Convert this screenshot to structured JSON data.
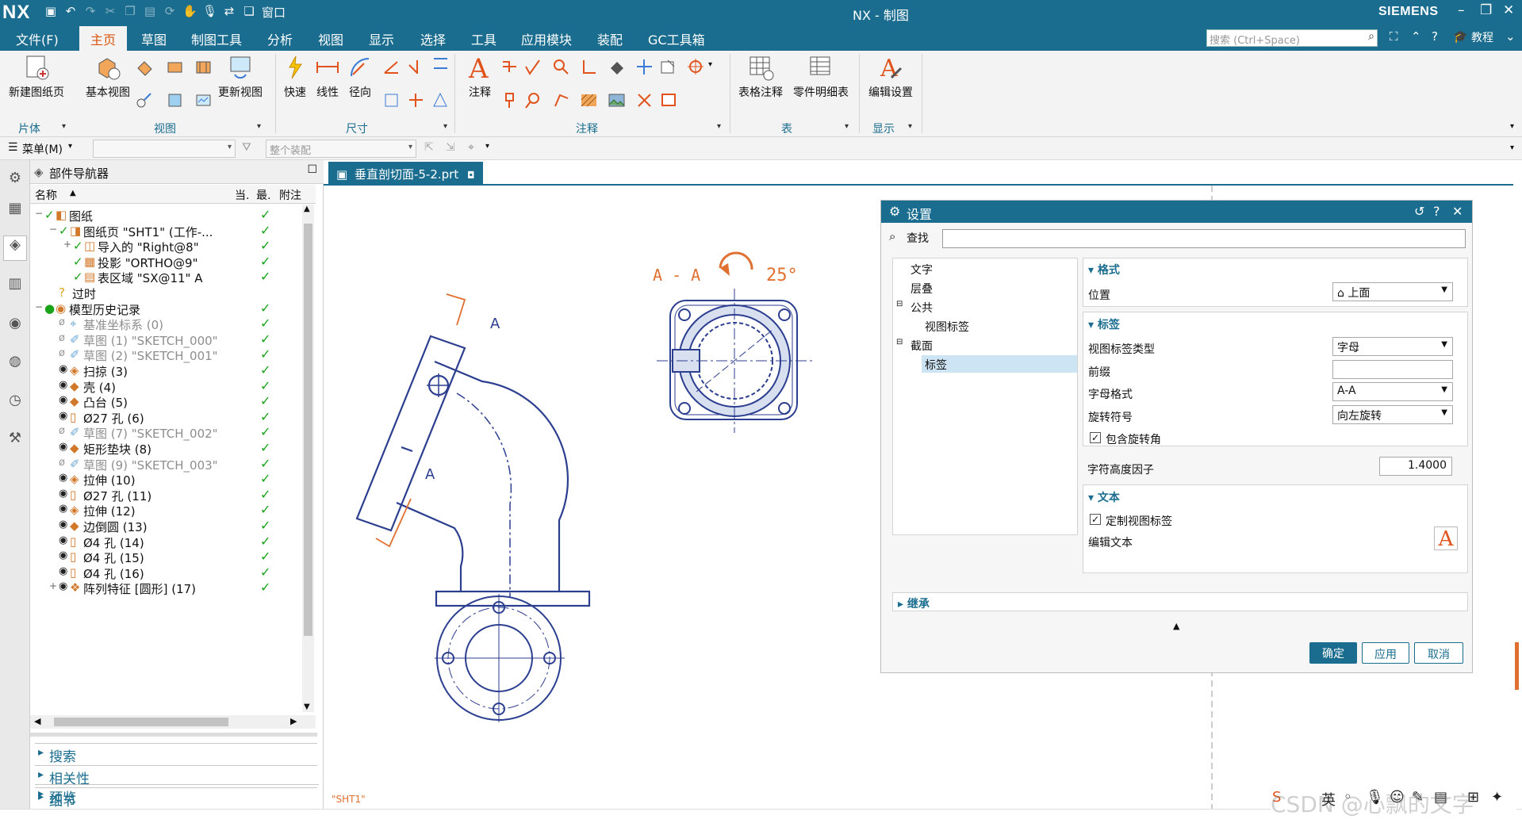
{
  "app": {
    "logo": "NX",
    "title": "NX - 制图",
    "brand": "SIEMENS",
    "menu_window": "窗口"
  },
  "menu": {
    "tabs": [
      "文件(F)",
      "主页",
      "草图",
      "制图工具",
      "分析",
      "视图",
      "显示",
      "选择",
      "工具",
      "应用模块",
      "装配",
      "GC工具箱"
    ],
    "search_placeholder": "搜索 (Ctrl+Space)",
    "tutorial": "教程"
  },
  "ribbon": {
    "buttons": {
      "new_sheet": "新建图纸页",
      "base_view": "基本视图",
      "update_view": "更新视图",
      "rapid": "快速",
      "linear": "线性",
      "radial": "径向",
      "note": "注释",
      "table_note": "表格注释",
      "parts_list": "零件明细表",
      "edit_settings": "编辑设置"
    },
    "groups": {
      "body": "片体",
      "view": "视图",
      "dimension": "尺寸",
      "annotation": "注释",
      "table": "表",
      "display": "显示"
    }
  },
  "toolbar2": {
    "menu": "菜单(M)",
    "assembly_placeholder": "整个装配"
  },
  "navigator": {
    "title": "部件导航器",
    "columns": [
      "名称",
      "当.",
      "最.",
      "附注"
    ],
    "rows": [
      {
        "text": "图纸",
        "indent": 0,
        "expand": "−",
        "grey": false,
        "check": true
      },
      {
        "text": "图纸页 \"SHT1\" (工作-...",
        "indent": 1,
        "expand": "−",
        "grey": false,
        "check": true
      },
      {
        "text": "导入的 \"Right@8\"",
        "indent": 2,
        "expand": "+",
        "grey": false,
        "check": true
      },
      {
        "text": "投影 \"ORTHO@9\"",
        "indent": 2,
        "expand": "",
        "grey": false,
        "check": true
      },
      {
        "text": "表区域 \"SX@11\" A",
        "indent": 2,
        "expand": "",
        "grey": false,
        "check": true
      },
      {
        "text": "过时",
        "indent": 1,
        "expand": "",
        "grey": false,
        "check": false
      },
      {
        "text": "模型历史记录",
        "indent": 0,
        "expand": "−",
        "grey": false,
        "check": true
      },
      {
        "text": "基准坐标系 (0)",
        "indent": 1,
        "expand": "",
        "grey": true,
        "check": true
      },
      {
        "text": "草图 (1) \"SKETCH_000\"",
        "indent": 1,
        "expand": "",
        "grey": true,
        "check": true
      },
      {
        "text": "草图 (2) \"SKETCH_001\"",
        "indent": 1,
        "expand": "",
        "grey": true,
        "check": true
      },
      {
        "text": "扫掠 (3)",
        "indent": 1,
        "expand": "",
        "grey": false,
        "check": true
      },
      {
        "text": "壳 (4)",
        "indent": 1,
        "expand": "",
        "grey": false,
        "check": true
      },
      {
        "text": "凸台 (5)",
        "indent": 1,
        "expand": "",
        "grey": false,
        "check": true
      },
      {
        "text": "Ø27 孔 (6)",
        "indent": 1,
        "expand": "",
        "grey": false,
        "check": true
      },
      {
        "text": "草图 (7) \"SKETCH_002\"",
        "indent": 1,
        "expand": "",
        "grey": true,
        "check": true
      },
      {
        "text": "矩形垫块 (8)",
        "indent": 1,
        "expand": "",
        "grey": false,
        "check": true
      },
      {
        "text": "草图 (9) \"SKETCH_003\"",
        "indent": 1,
        "expand": "",
        "grey": true,
        "check": true
      },
      {
        "text": "拉伸 (10)",
        "indent": 1,
        "expand": "",
        "grey": false,
        "check": true
      },
      {
        "text": "Ø27 孔 (11)",
        "indent": 1,
        "expand": "",
        "grey": false,
        "check": true
      },
      {
        "text": "拉伸 (12)",
        "indent": 1,
        "expand": "",
        "grey": false,
        "check": true
      },
      {
        "text": "边倒圆 (13)",
        "indent": 1,
        "expand": "",
        "grey": false,
        "check": true
      },
      {
        "text": "Ø4 孔 (14)",
        "indent": 1,
        "expand": "",
        "grey": false,
        "check": true
      },
      {
        "text": "Ø4 孔 (15)",
        "indent": 1,
        "expand": "",
        "grey": false,
        "check": true
      },
      {
        "text": "Ø4 孔 (16)",
        "indent": 1,
        "expand": "",
        "grey": false,
        "check": true
      },
      {
        "text": "阵列特征 [圆形] (17)",
        "indent": 1,
        "expand": "+",
        "grey": false,
        "check": true
      }
    ],
    "sections": [
      "搜索",
      "相关性",
      "细节",
      "预览"
    ]
  },
  "doc_tab": "垂直剖切面-5-2.prt",
  "drawing": {
    "section_label": "A - A",
    "rotation_angle": "25°",
    "cut_letter": "A",
    "sheet_label": "\"SHT1\""
  },
  "dialog": {
    "title": "设置",
    "find_label": "查找",
    "tree": [
      "文字",
      "层叠",
      "公共",
      "视图标签",
      "截面",
      "标签"
    ],
    "format_header": "格式",
    "position_label": "位置",
    "position_value": "上面",
    "label_header": "标签",
    "view_label_type": "视图标签类型",
    "view_label_type_value": "字母",
    "prefix": "前缀",
    "letter_format": "字母格式",
    "letter_format_value": "A-A",
    "rotation_symbol": "旋转符号",
    "rotation_symbol_value": "向左旋转",
    "include_rotation": "包含旋转角",
    "char_height_factor": "字符高度因子",
    "char_height_value": "1.4000",
    "text_header": "文本",
    "custom_view_label": "定制视图标签",
    "edit_text": "编辑文本",
    "inherit": "继承",
    "ok": "确定",
    "apply": "应用",
    "cancel": "取消"
  },
  "status": {
    "ime": "英",
    "watermark": "CSDN @心飘的文字"
  }
}
